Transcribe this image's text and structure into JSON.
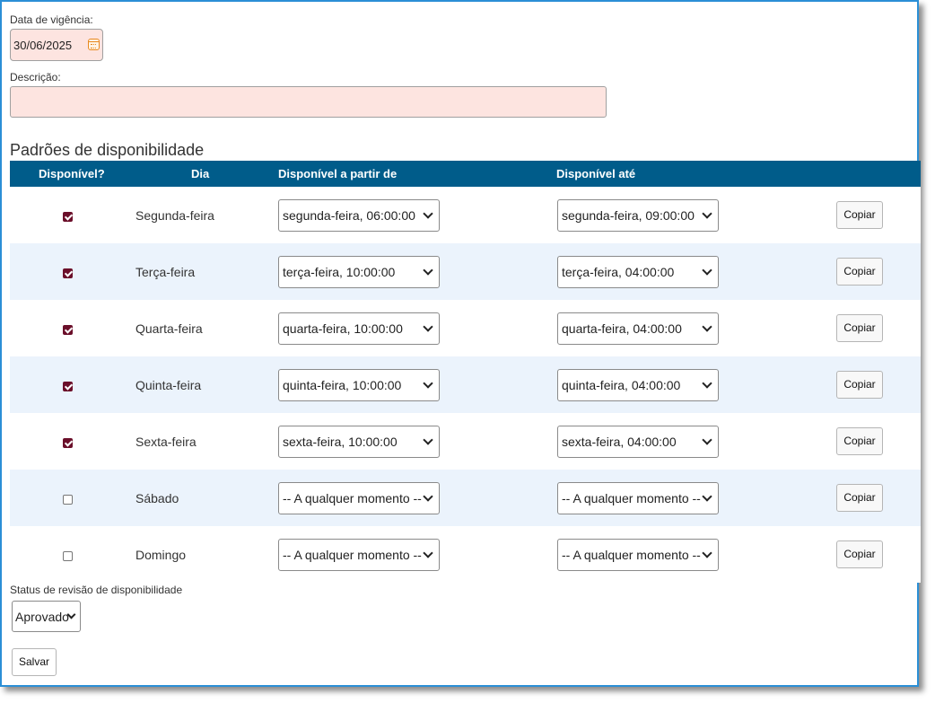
{
  "form": {
    "date_label": "Data de vigência:",
    "date_value": "30/06/2025",
    "description_label": "Descrição:",
    "description_value": ""
  },
  "section_title": "Padrões de disponibilidade",
  "table": {
    "headers": {
      "available": "Disponível?",
      "day": "Dia",
      "from": "Disponível a partir de",
      "to": "Disponível até"
    },
    "rows": [
      {
        "checked": true,
        "day": "Segunda-feira",
        "from": "segunda-feira, 06:00:00",
        "to": "segunda-feira, 09:00:00",
        "copy": "Copiar"
      },
      {
        "checked": true,
        "day": "Terça-feira",
        "from": "terça-feira, 10:00:00",
        "to": "terça-feira, 04:00:00",
        "copy": "Copiar"
      },
      {
        "checked": true,
        "day": "Quarta-feira",
        "from": "quarta-feira, 10:00:00",
        "to": "quarta-feira, 04:00:00",
        "copy": "Copiar"
      },
      {
        "checked": true,
        "day": "Quinta-feira",
        "from": "quinta-feira, 10:00:00",
        "to": "quinta-feira, 04:00:00",
        "copy": "Copiar"
      },
      {
        "checked": true,
        "day": "Sexta-feira",
        "from": "sexta-feira, 10:00:00",
        "to": "sexta-feira, 04:00:00",
        "copy": "Copiar"
      },
      {
        "checked": false,
        "day": "Sábado",
        "from": "-- A qualquer momento --",
        "to": "-- A qualquer momento --",
        "copy": "Copiar"
      },
      {
        "checked": false,
        "day": "Domingo",
        "from": "-- A qualquer momento --",
        "to": "-- A qualquer momento --",
        "copy": "Copiar"
      }
    ]
  },
  "review": {
    "label": "Status de revisão de disponibilidade",
    "value": "Aprovado"
  },
  "save_label": "Salvar",
  "colors": {
    "header_bg": "#005c8a",
    "row_alt_bg": "#ebf3fc",
    "required_field_bg": "#fde4e0",
    "checkbox_checked": "#6b0f2a",
    "frame_border": "#2b8fd6"
  }
}
